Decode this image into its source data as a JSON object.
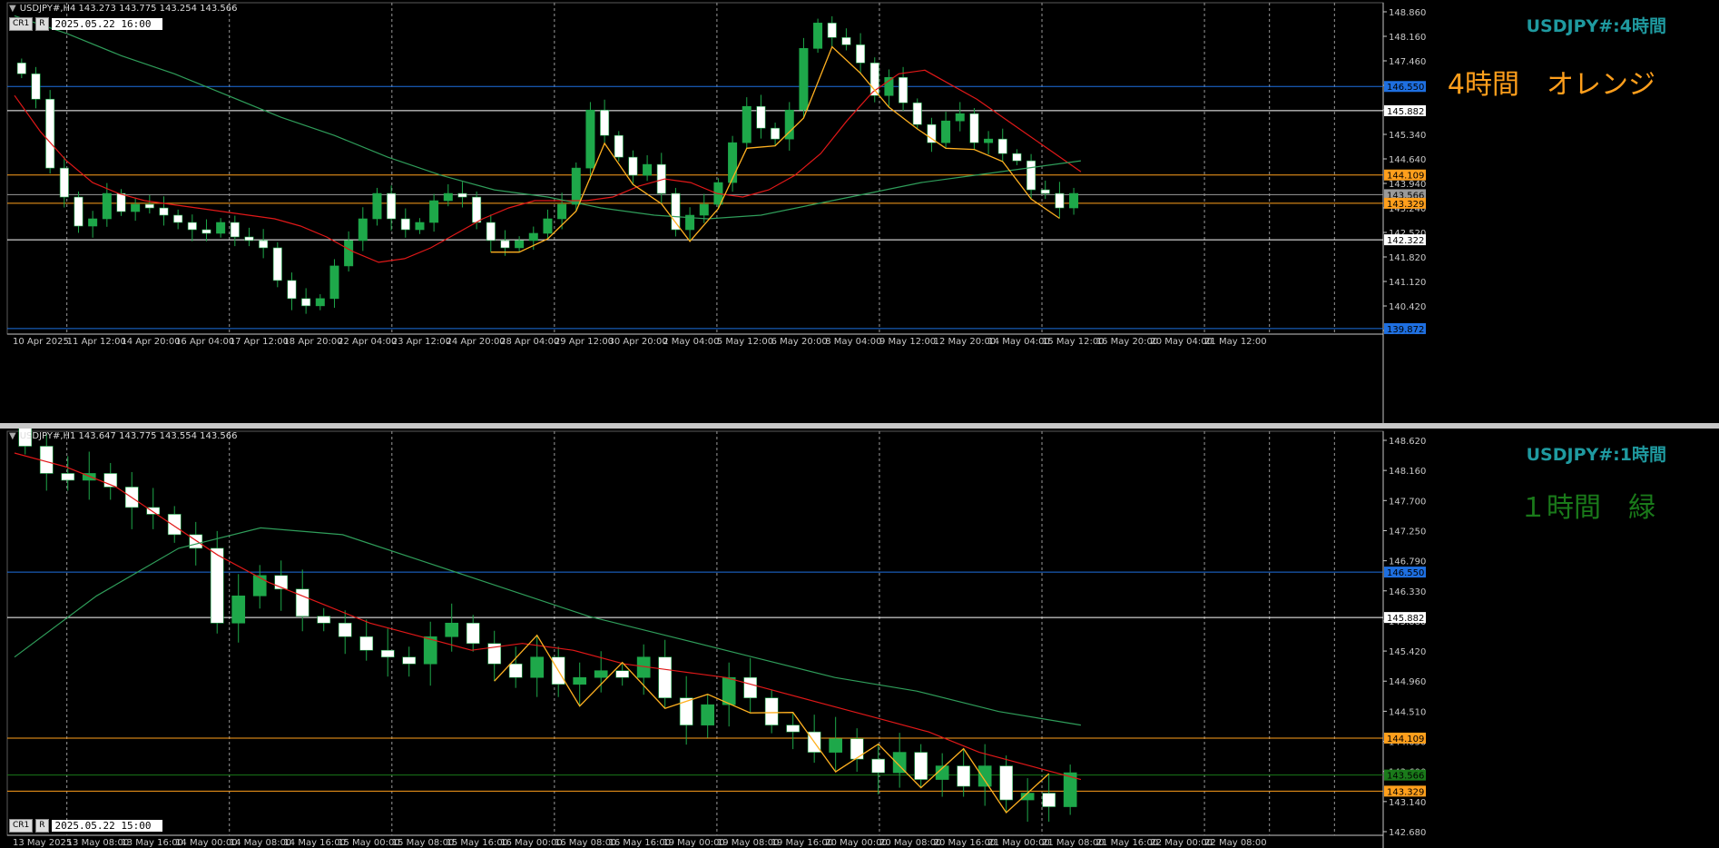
{
  "top_chart": {
    "header": "USDJPY#,H4  143.273 143.775 143.254 143.566",
    "timestamp": "2025.05.22 16:00",
    "buttons": [
      "CR1",
      "R"
    ],
    "symbol_label": "USDJPY#:4時間",
    "note": "4時間　オレンジ",
    "colors": {
      "symbol": "#1f9aa0",
      "note": "#ff9f1c"
    },
    "price_ticks": [
      "148.860",
      "148.160",
      "147.460",
      "146.760",
      "146.040",
      "145.340",
      "144.640",
      "143.940",
      "143.240",
      "142.520",
      "141.820",
      "141.120",
      "140.420",
      "139.720"
    ],
    "hlines": [
      {
        "label": "146.550",
        "color": "#1e6fe0"
      },
      {
        "label": "145.882",
        "color": "#ffffff"
      },
      {
        "label": "144.109",
        "color": "#ff9f1c"
      },
      {
        "label": "143.566",
        "color": "#9a9a9a"
      },
      {
        "label": "143.329",
        "color": "#ff9f1c"
      },
      {
        "label": "142.322",
        "color": "#ffffff"
      },
      {
        "label": "139.872",
        "color": "#1e6fe0"
      }
    ],
    "time_ticks": [
      "10 Apr 2025",
      "11 Apr 12:00",
      "14 Apr 20:00",
      "16 Apr 04:00",
      "17 Apr 12:00",
      "18 Apr 20:00",
      "22 Apr 04:00",
      "23 Apr 12:00",
      "24 Apr 20:00",
      "28 Apr 04:00",
      "29 Apr 12:00",
      "30 Apr 20:00",
      "2 May 04:00",
      "5 May 12:00",
      "6 May 20:00",
      "8 May 04:00",
      "9 May 12:00",
      "12 May 20:00",
      "14 May 04:00",
      "15 May 12:00",
      "16 May 20:00",
      "20 May 04:00",
      "21 May 12:00"
    ]
  },
  "bottom_chart": {
    "header": "USDJPY#,H1  143.647 143.775 143.554 143.566",
    "timestamp": "2025.05.22 15:00",
    "buttons": [
      "CR1",
      "R"
    ],
    "symbol_label": "USDJPY#:1時間",
    "note": "１時間　緑",
    "colors": {
      "symbol": "#1f9aa0",
      "note": "#1a7a1a"
    },
    "price_ticks": [
      "148.620",
      "148.160",
      "147.700",
      "147.250",
      "146.790",
      "146.330",
      "145.880",
      "145.420",
      "144.960",
      "144.510",
      "144.050",
      "143.600",
      "143.140",
      "142.680"
    ],
    "hlines": [
      {
        "label": "146.550",
        "color": "#1e6fe0"
      },
      {
        "label": "145.882",
        "color": "#ffffff"
      },
      {
        "label": "144.109",
        "color": "#ff9f1c"
      },
      {
        "label": "143.566",
        "color": "#1a7a1a"
      },
      {
        "label": "143.329",
        "color": "#ff9f1c"
      }
    ],
    "time_ticks": [
      "13 May 2025",
      "13 May 08:00",
      "13 May 16:00",
      "14 May 00:00",
      "14 May 08:00",
      "14 May 16:00",
      "15 May 00:00",
      "15 May 08:00",
      "15 May 16:00",
      "16 May 00:00",
      "16 May 08:00",
      "16 May 16:00",
      "19 May 00:00",
      "19 May 08:00",
      "19 May 16:00",
      "20 May 00:00",
      "20 May 08:00",
      "20 May 16:00",
      "21 May 00:00",
      "21 May 08:00",
      "21 May 16:00",
      "22 May 00:00",
      "22 May 08:00"
    ]
  },
  "chart_data": [
    {
      "type": "candlestick",
      "title": "USDJPY#,H4",
      "ylim": [
        139.72,
        148.86
      ],
      "series": [
        {
          "name": "close",
          "values": [
            146.9,
            146.2,
            144.3,
            143.5,
            142.7,
            142.9,
            143.6,
            143.1,
            143.3,
            143.2,
            143.0,
            142.8,
            142.6,
            142.5,
            142.8,
            142.4,
            142.3,
            142.1,
            141.2,
            140.7,
            140.5,
            140.7,
            141.6,
            142.3,
            142.9,
            143.6,
            142.9,
            142.6,
            142.8,
            143.4,
            143.6,
            143.5,
            142.8,
            142.3,
            142.1,
            142.3,
            142.5,
            142.9,
            143.3,
            144.3,
            145.9,
            145.2,
            144.6,
            144.1,
            144.4,
            143.6,
            142.6,
            143.0,
            143.3,
            143.9,
            145.0,
            146.0,
            145.4,
            145.1,
            145.9,
            147.6,
            148.3,
            147.9,
            147.7,
            147.2,
            146.3,
            146.8,
            146.1,
            145.5,
            145.0,
            145.6,
            145.8,
            145.0,
            145.1,
            144.7,
            144.5,
            143.7,
            143.6,
            143.2,
            143.6
          ]
        },
        {
          "name": "MA (red)",
          "values": [
            146.3,
            145.3,
            144.5,
            143.9,
            143.6,
            143.4,
            143.3,
            143.2,
            143.1,
            143.0,
            142.9,
            142.7,
            142.4,
            142.0,
            141.7,
            141.8,
            142.1,
            142.5,
            142.9,
            143.2,
            143.4,
            143.4,
            143.4,
            143.5,
            143.8,
            144.0,
            143.9,
            143.6,
            143.5,
            143.7,
            144.1,
            144.7,
            145.6,
            146.4,
            146.9,
            147.0,
            146.6,
            146.2,
            145.7,
            145.2,
            144.7,
            144.2
          ]
        },
        {
          "name": "MA (green)",
          "values": [
            148.5,
            148.0,
            147.4,
            146.9,
            146.3,
            145.7,
            145.2,
            144.6,
            144.1,
            143.7,
            143.5,
            143.2,
            143.0,
            142.9,
            143.0,
            143.3,
            143.6,
            143.9,
            144.1,
            144.3,
            144.5
          ]
        }
      ]
    },
    {
      "type": "candlestick",
      "title": "USDJPY#,H1",
      "ylim": [
        142.68,
        148.62
      ],
      "series": [
        {
          "name": "close",
          "values": [
            148.4,
            148.0,
            147.9,
            148.0,
            147.8,
            147.5,
            147.4,
            147.1,
            146.9,
            145.8,
            146.2,
            146.5,
            146.3,
            145.9,
            145.8,
            145.6,
            145.4,
            145.3,
            145.2,
            145.6,
            145.8,
            145.5,
            145.2,
            145.0,
            145.3,
            144.9,
            145.0,
            145.1,
            145.0,
            145.3,
            144.7,
            144.3,
            144.6,
            145.0,
            144.7,
            144.3,
            144.2,
            143.9,
            144.1,
            143.8,
            143.6,
            143.9,
            143.5,
            143.7,
            143.4,
            143.7,
            143.2,
            143.3,
            143.1,
            143.6
          ]
        },
        {
          "name": "MA (red)",
          "values": [
            148.3,
            148.1,
            147.8,
            147.3,
            146.8,
            146.4,
            146.1,
            145.8,
            145.6,
            145.4,
            145.5,
            145.4,
            145.2,
            145.1,
            145.0,
            144.8,
            144.6,
            144.4,
            144.2,
            143.9,
            143.7,
            143.5
          ]
        },
        {
          "name": "MA (green)",
          "values": [
            145.3,
            146.2,
            146.9,
            147.2,
            147.1,
            146.7,
            146.3,
            145.9,
            145.6,
            145.3,
            145.0,
            144.8,
            144.5,
            144.3
          ]
        }
      ]
    }
  ]
}
